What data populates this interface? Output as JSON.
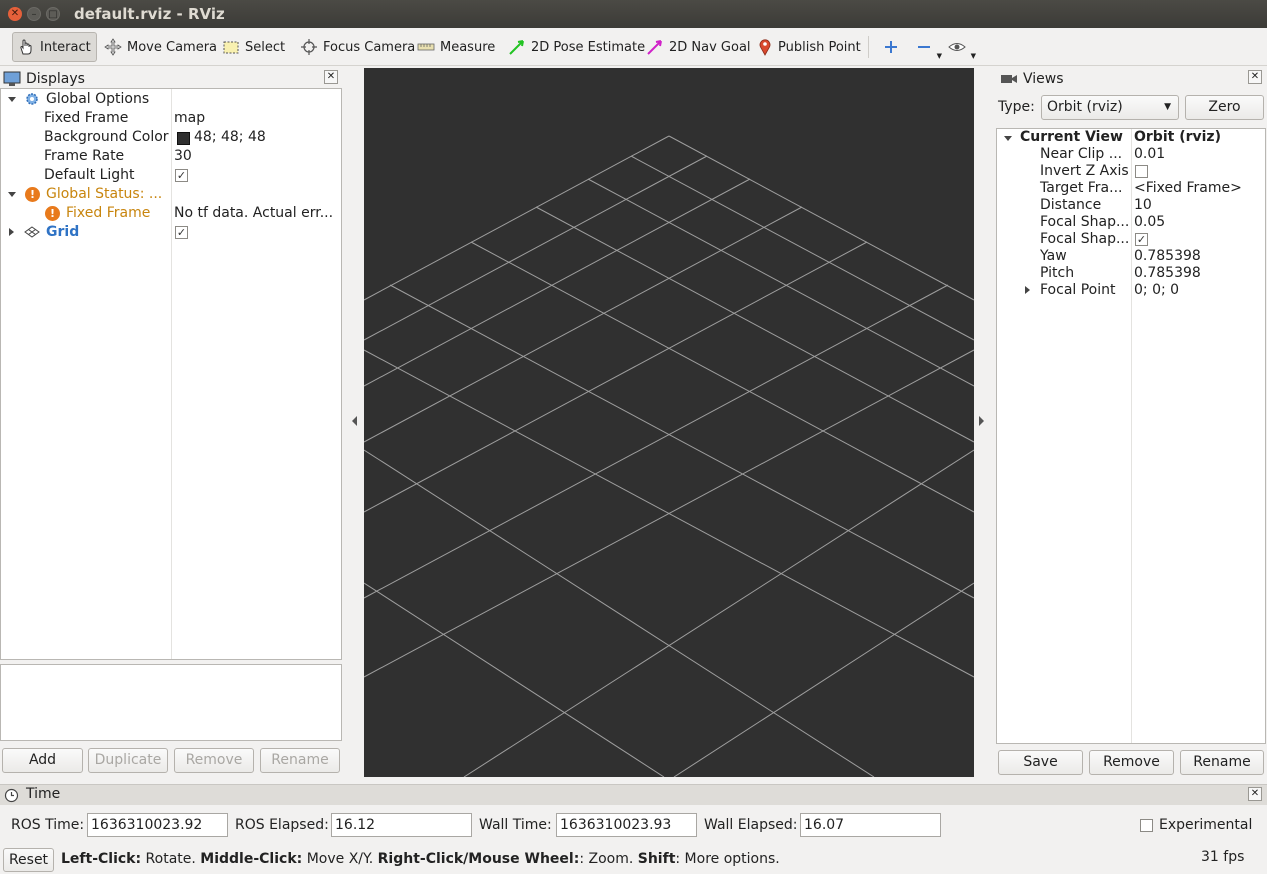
{
  "window": {
    "title": "default.rviz - RViz"
  },
  "toolbar": {
    "tools": [
      {
        "label": "Interact",
        "icon": "hand-icon"
      },
      {
        "label": "Move Camera",
        "icon": "move-camera-icon"
      },
      {
        "label": "Select",
        "icon": "select-icon"
      },
      {
        "label": "Focus Camera",
        "icon": "focus-camera-icon"
      },
      {
        "label": "Measure",
        "icon": "ruler-icon"
      },
      {
        "label": "2D Pose Estimate",
        "icon": "pose-estimate-icon"
      },
      {
        "label": "2D Nav Goal",
        "icon": "nav-goal-icon"
      },
      {
        "label": "Publish Point",
        "icon": "map-pin-icon"
      }
    ],
    "active_tool": "Interact"
  },
  "displays": {
    "title": "Displays",
    "global_options": {
      "label": "Global Options",
      "fixed_frame_label": "Fixed Frame",
      "fixed_frame_value": "map",
      "background_color_label": "Background Color",
      "background_color_value": "48; 48; 48",
      "background_color_swatch": "#303030",
      "frame_rate_label": "Frame Rate",
      "frame_rate_value": "30",
      "default_light_label": "Default Light",
      "default_light_checked": true
    },
    "global_status": {
      "label": "Global Status: ...",
      "fixed_frame_label": "Fixed Frame",
      "fixed_frame_value": "No tf data.  Actual err..."
    },
    "grid": {
      "label": "Grid",
      "checked": true
    },
    "buttons": {
      "add": "Add",
      "duplicate": "Duplicate",
      "remove": "Remove",
      "rename": "Rename"
    }
  },
  "views": {
    "title": "Views",
    "type_label": "Type:",
    "type_value": "Orbit (rviz)",
    "zero_button": "Zero",
    "current_view_label": "Current View",
    "current_view_value": "Orbit (rviz)",
    "props": [
      {
        "label": "Near Clip ...",
        "value": "0.01"
      },
      {
        "label": "Invert Z Axis",
        "value": ""
      },
      {
        "label": "Target Fra...",
        "value": "<Fixed Frame>"
      },
      {
        "label": "Distance",
        "value": "10"
      },
      {
        "label": "Focal Shap...",
        "value": "0.05"
      },
      {
        "label": "Focal Shap...",
        "value": ""
      },
      {
        "label": "Yaw",
        "value": "0.785398"
      },
      {
        "label": "Pitch",
        "value": "0.785398"
      },
      {
        "label": "Focal Point",
        "value": "0; 0; 0"
      }
    ],
    "buttons": {
      "save": "Save",
      "remove": "Remove",
      "rename": "Rename"
    }
  },
  "time": {
    "title": "Time",
    "ros_time_label": "ROS Time:",
    "ros_time_value": "1636310023.92",
    "ros_elapsed_label": "ROS Elapsed:",
    "ros_elapsed_value": "16.12",
    "wall_time_label": "Wall Time:",
    "wall_time_value": "1636310023.93",
    "wall_elapsed_label": "Wall Elapsed:",
    "wall_elapsed_value": "16.07",
    "experimental_label": "Experimental"
  },
  "statusbar": {
    "reset": "Reset",
    "left_click": "Left-Click:",
    "left_click_desc": " Rotate. ",
    "middle_click": "Middle-Click:",
    "middle_click_desc": " Move X/Y. ",
    "right_click": "Right-Click/Mouse Wheel:",
    "right_click_desc": ": Zoom. ",
    "shift": "Shift",
    "shift_desc": ": More options.",
    "fps": "31 fps"
  },
  "colors": {
    "viewport_bg": "#303030",
    "grid_line": "#a0a0a0",
    "warning": "#e87a1c"
  }
}
